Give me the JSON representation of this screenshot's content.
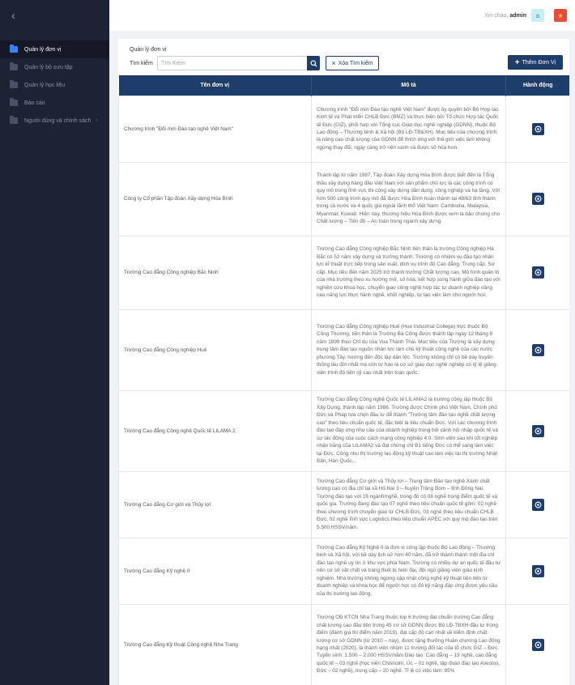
{
  "sidebar": {
    "collapse_glyph": "‹",
    "items": [
      {
        "label": "Quản lý đơn vị",
        "active": true
      },
      {
        "label": "Quản lý bộ sưu tập"
      },
      {
        "label": "Quản lý học liệu"
      },
      {
        "label": "Báo cáo"
      },
      {
        "label": "Người dùng và chính sách",
        "arrow": "›"
      }
    ]
  },
  "header": {
    "greeting": "Xin chào,",
    "username": "admin",
    "avatar_letter": "a",
    "flag_glyph": "★"
  },
  "main": {
    "breadcrumb": "Quản lý đơn vị",
    "search_label": "Tìm kiếm",
    "search_placeholder": "Tìm Kiếm",
    "clear_label": "Xóa Tìm kiếm",
    "add_label": "Thêm Đơn Vị"
  },
  "table": {
    "columns": [
      "Tên đơn vị",
      "Mô tả",
      "Hành động"
    ],
    "rows": [
      {
        "name": "Chương trình \"Đổi mới Đào tạo nghề Việt Nam\"",
        "desc": "Chương trình \"Đổi mới Đào tạo nghề Việt Nam\" được ủy quyền bởi Bộ Hợp tác Kinh tế và Phát triển CHLB Đức (BMZ) và thực hiện bởi Tổ chức Hợp tác Quốc tế Đức (GIZ), phối hợp với Tổng cục Giáo dục nghề nghiệp (GDNN), thuộc Bộ Lao động – Thương binh & Xã hội (Bộ LĐ-TB&XH). Mục tiêu của chương trình là nâng cao chất lượng của GDNN để thích ứng với thế giới việc làm không ngừng thay đổi, ngày càng trở nên xanh và được số hóa hơn."
      },
      {
        "name": "Công ty Cổ phần Tập đoàn Xây dựng Hòa Bình",
        "desc": "Thành lập từ năm 1987, Tập đoàn Xây dựng Hòa Bình được biết đến là Tổng thầu xây dựng hàng đầu Việt Nam với sản phẩm chủ lực là các công trình có quy mô trong lĩnh vực thi công xây dựng dân dụng, công nghiệp và hạ tầng. Với hơn 500 công trình quy mô đã được Hòa Bình hoàn thành tại 48/63 tỉnh thành trong cả nước và 4 quốc gia ngoài lãnh thổ Việt Nam: Cambodia, Malaysia, Myanmar, Kuwait. Hiện nay, thương hiệu Hòa Bình được xem là bảo chứng cho Chất lượng – Tiến độ – An toàn trong ngành xây dựng."
      },
      {
        "name": "Trường Cao đẳng Công nghiệp Bắc Ninh",
        "desc": "Trường Cao đẳng Công nghiệp Bắc Ninh tiền thân là trường Công nghiệp Hà Bắc có 52 năm xây dựng và trưởng thành. Trường có nhiệm vụ đào tạo nhân lực kĩ thuật trực tiếp trong sản xuất, dịch vụ trình độ Cao đẳng, Trung cấp, Sơ cấp. Mục tiêu đến năm 2025 trở thành trường Chất lượng cao. Mô hình quản trị của nhà trường theo xu hướng mở, số hóa; kết hợp song hành giữa đào tạo với nghiên cứu khoa học, chuyển giao công nghệ hợp tác tư doanh nghiệp nâng cao năng lực thực hành nghề, khởi nghiệp, tự tạo việc làm cho người học."
      },
      {
        "name": "Trường Cao đẳng Công nghiệp Huế",
        "desc": "Trường Cao đẳng Công nghiệp Huế (Hue Industrial College) trực thuộc Bộ Công Thương, tiền thân là Trường Bá Công được thành lập ngày 12 tháng 9 năm 1899 theo Chỉ dụ của Vua Thành Thái. Mục tiêu của Trường là xây dựng trung tâm đào tạo nguồn nhân lực làm chủ kỹ thuật công nghệ của các nước phương Tây, hướng đến độc lập dân tộc. Trường không chỉ có bề dày truyền thống lâu đời nhất mà còn tự hào là cơ sở giáo dục nghề nghiệp có tỷ lệ giảng viên trình độ tiến sỹ cao nhất trên toàn quốc."
      },
      {
        "name": "Trường Cao đẳng Công nghệ Quốc tế LILAMA 2",
        "desc": "Trường Cao đẳng Công nghệ Quốc tế LILAMA2 là trường công lập thuộc Bộ Xây Dựng, thành lập năm 1986. Trường được Chính phủ Việt Nam, Chính phủ Đức và Pháp lựa chọn đầu tư để thành \"Trường tâm đào tạo nghề chất lượng cao\" theo tiêu chuẩn quốc tế, đặc biệt là tiêu chuẩn Đức. Với các chương trình đào tạo đáp ứng nhu cầu của doanh nghiệp trong bối cảnh hội nhập quốc tế và sự tác động của cuộc cách mạng công nghiệp 4.0. Sinh viên sau khi tốt nghiệp nhận bằng của LILAMA2 và đạt chứng chỉ B1 tiếng Đức có thể sang làm việc tại Đức. Công nhu thị trường lao động kỹ thuật cao làm việc tại thị trường Nhật Bản, Hàn Quốc..."
      },
      {
        "name": "Trường Cao đẳng Cơ giới và Thủy lợi",
        "desc": "Trường Cao đẳng Cơ giới và Thủy lợi – Trung tâm Đào tạo nghề Xanh chất lượng cao có địa chỉ tại xã Hố Nai 3 – huyện Trảng Bom – tỉnh Đồng Nai. Trường đào tạo với 16 ngành/nghề, trong đó có 08 nghề trọng điểm quốc tế và quốc gia. Trường đang đào tạo 07 nghề theo tiêu chuẩn quốc tế gồm: 02 nghề theo chương trình chuyển giao từ CHLB Đức, 03 nghề theo tiêu chuẩn CHLB Đức, 02 nghề lĩnh vực Logistics theo tiêu chuẩn APEC với quy mô đào tạo trên 5.500 HSSV/năm."
      },
      {
        "name": "Trường Cao đẳng Kỹ nghệ II",
        "desc": "Trường Cao đẳng Kỹ Nghệ II là đơn vị công lập thuộc Bộ Lao động – Thương binh và Xã hội, với bề dày lịch sử hơn 40 năm, đã trở thành thành một địa chỉ đào tạo nghề uy tín ở khu vực phía Nam. Trường có nhiều dự án quốc tế đầu tư nên cơ sở vật chất và trang thiết bị hiện đại, đội ngũ giảng viên giàu kinh nghiệm. Nhà trường không ngừng cập nhật công nghệ kỹ thuật tiên tiến từ doanh nghiệp và khoa học để người học có đủ kỹ năng đáp ứng được yêu cầu của thị trường lao động."
      },
      {
        "name": "Trường Cao đẳng Kỹ thuật Công nghệ Nha Trang",
        "desc": "Trường CĐ KTCN Nha Trang thuộc top 6 trường đạt chuẩn trường Cao đẳng chất lượng cao đầu tiên trong 45 cơ sở GDNN được Bộ LĐ-TBXH đầu tư trọng điểm (đánh giá thí điểm năm 2019), đạt cấp độ cao nhất về kiểm định chất lượng cơ sở GDNN (từ 2010 – nay), được tặng thưởng Huân chương Lao động hạng nhất (2020), là thành viên nhóm 11 trường đối tác của tổ chức GIZ – Đức. Tuyển sinh: 1.500 – 2.000 HSSV/năm Đào tạo: Cao đẳng – 19 nghề, cao đẳng quốc tế – 03 nghề (học viên Chisholm, Úc – 01 nghề, tập đoàn đào tạo Avestos, Đức – 02 nghề), trung cấp – 20 nghề. Tỉ lệ có việc làm: 95%"
      }
    ]
  }
}
